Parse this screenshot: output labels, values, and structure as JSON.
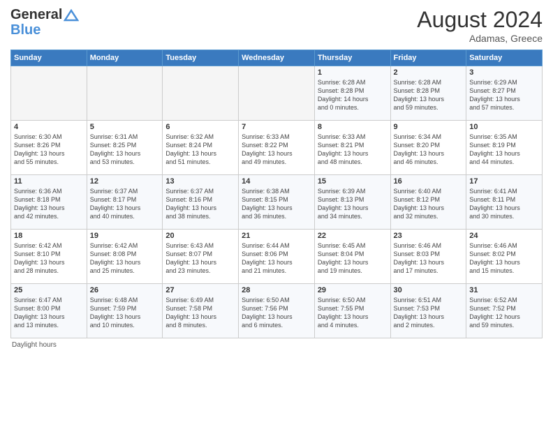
{
  "header": {
    "logo_line1": "General",
    "logo_line2": "Blue",
    "month_year": "August 2024",
    "location": "Adamas, Greece"
  },
  "footer": {
    "daylight_note": "Daylight hours"
  },
  "days_of_week": [
    "Sunday",
    "Monday",
    "Tuesday",
    "Wednesday",
    "Thursday",
    "Friday",
    "Saturday"
  ],
  "weeks": [
    [
      {
        "num": "",
        "info": ""
      },
      {
        "num": "",
        "info": ""
      },
      {
        "num": "",
        "info": ""
      },
      {
        "num": "",
        "info": ""
      },
      {
        "num": "1",
        "info": "Sunrise: 6:28 AM\nSunset: 8:28 PM\nDaylight: 14 hours\nand 0 minutes."
      },
      {
        "num": "2",
        "info": "Sunrise: 6:28 AM\nSunset: 8:28 PM\nDaylight: 13 hours\nand 59 minutes."
      },
      {
        "num": "3",
        "info": "Sunrise: 6:29 AM\nSunset: 8:27 PM\nDaylight: 13 hours\nand 57 minutes."
      }
    ],
    [
      {
        "num": "4",
        "info": "Sunrise: 6:30 AM\nSunset: 8:26 PM\nDaylight: 13 hours\nand 55 minutes."
      },
      {
        "num": "5",
        "info": "Sunrise: 6:31 AM\nSunset: 8:25 PM\nDaylight: 13 hours\nand 53 minutes."
      },
      {
        "num": "6",
        "info": "Sunrise: 6:32 AM\nSunset: 8:24 PM\nDaylight: 13 hours\nand 51 minutes."
      },
      {
        "num": "7",
        "info": "Sunrise: 6:33 AM\nSunset: 8:22 PM\nDaylight: 13 hours\nand 49 minutes."
      },
      {
        "num": "8",
        "info": "Sunrise: 6:33 AM\nSunset: 8:21 PM\nDaylight: 13 hours\nand 48 minutes."
      },
      {
        "num": "9",
        "info": "Sunrise: 6:34 AM\nSunset: 8:20 PM\nDaylight: 13 hours\nand 46 minutes."
      },
      {
        "num": "10",
        "info": "Sunrise: 6:35 AM\nSunset: 8:19 PM\nDaylight: 13 hours\nand 44 minutes."
      }
    ],
    [
      {
        "num": "11",
        "info": "Sunrise: 6:36 AM\nSunset: 8:18 PM\nDaylight: 13 hours\nand 42 minutes."
      },
      {
        "num": "12",
        "info": "Sunrise: 6:37 AM\nSunset: 8:17 PM\nDaylight: 13 hours\nand 40 minutes."
      },
      {
        "num": "13",
        "info": "Sunrise: 6:37 AM\nSunset: 8:16 PM\nDaylight: 13 hours\nand 38 minutes."
      },
      {
        "num": "14",
        "info": "Sunrise: 6:38 AM\nSunset: 8:15 PM\nDaylight: 13 hours\nand 36 minutes."
      },
      {
        "num": "15",
        "info": "Sunrise: 6:39 AM\nSunset: 8:13 PM\nDaylight: 13 hours\nand 34 minutes."
      },
      {
        "num": "16",
        "info": "Sunrise: 6:40 AM\nSunset: 8:12 PM\nDaylight: 13 hours\nand 32 minutes."
      },
      {
        "num": "17",
        "info": "Sunrise: 6:41 AM\nSunset: 8:11 PM\nDaylight: 13 hours\nand 30 minutes."
      }
    ],
    [
      {
        "num": "18",
        "info": "Sunrise: 6:42 AM\nSunset: 8:10 PM\nDaylight: 13 hours\nand 28 minutes."
      },
      {
        "num": "19",
        "info": "Sunrise: 6:42 AM\nSunset: 8:08 PM\nDaylight: 13 hours\nand 25 minutes."
      },
      {
        "num": "20",
        "info": "Sunrise: 6:43 AM\nSunset: 8:07 PM\nDaylight: 13 hours\nand 23 minutes."
      },
      {
        "num": "21",
        "info": "Sunrise: 6:44 AM\nSunset: 8:06 PM\nDaylight: 13 hours\nand 21 minutes."
      },
      {
        "num": "22",
        "info": "Sunrise: 6:45 AM\nSunset: 8:04 PM\nDaylight: 13 hours\nand 19 minutes."
      },
      {
        "num": "23",
        "info": "Sunrise: 6:46 AM\nSunset: 8:03 PM\nDaylight: 13 hours\nand 17 minutes."
      },
      {
        "num": "24",
        "info": "Sunrise: 6:46 AM\nSunset: 8:02 PM\nDaylight: 13 hours\nand 15 minutes."
      }
    ],
    [
      {
        "num": "25",
        "info": "Sunrise: 6:47 AM\nSunset: 8:00 PM\nDaylight: 13 hours\nand 13 minutes."
      },
      {
        "num": "26",
        "info": "Sunrise: 6:48 AM\nSunset: 7:59 PM\nDaylight: 13 hours\nand 10 minutes."
      },
      {
        "num": "27",
        "info": "Sunrise: 6:49 AM\nSunset: 7:58 PM\nDaylight: 13 hours\nand 8 minutes."
      },
      {
        "num": "28",
        "info": "Sunrise: 6:50 AM\nSunset: 7:56 PM\nDaylight: 13 hours\nand 6 minutes."
      },
      {
        "num": "29",
        "info": "Sunrise: 6:50 AM\nSunset: 7:55 PM\nDaylight: 13 hours\nand 4 minutes."
      },
      {
        "num": "30",
        "info": "Sunrise: 6:51 AM\nSunset: 7:53 PM\nDaylight: 13 hours\nand 2 minutes."
      },
      {
        "num": "31",
        "info": "Sunrise: 6:52 AM\nSunset: 7:52 PM\nDaylight: 12 hours\nand 59 minutes."
      }
    ]
  ]
}
